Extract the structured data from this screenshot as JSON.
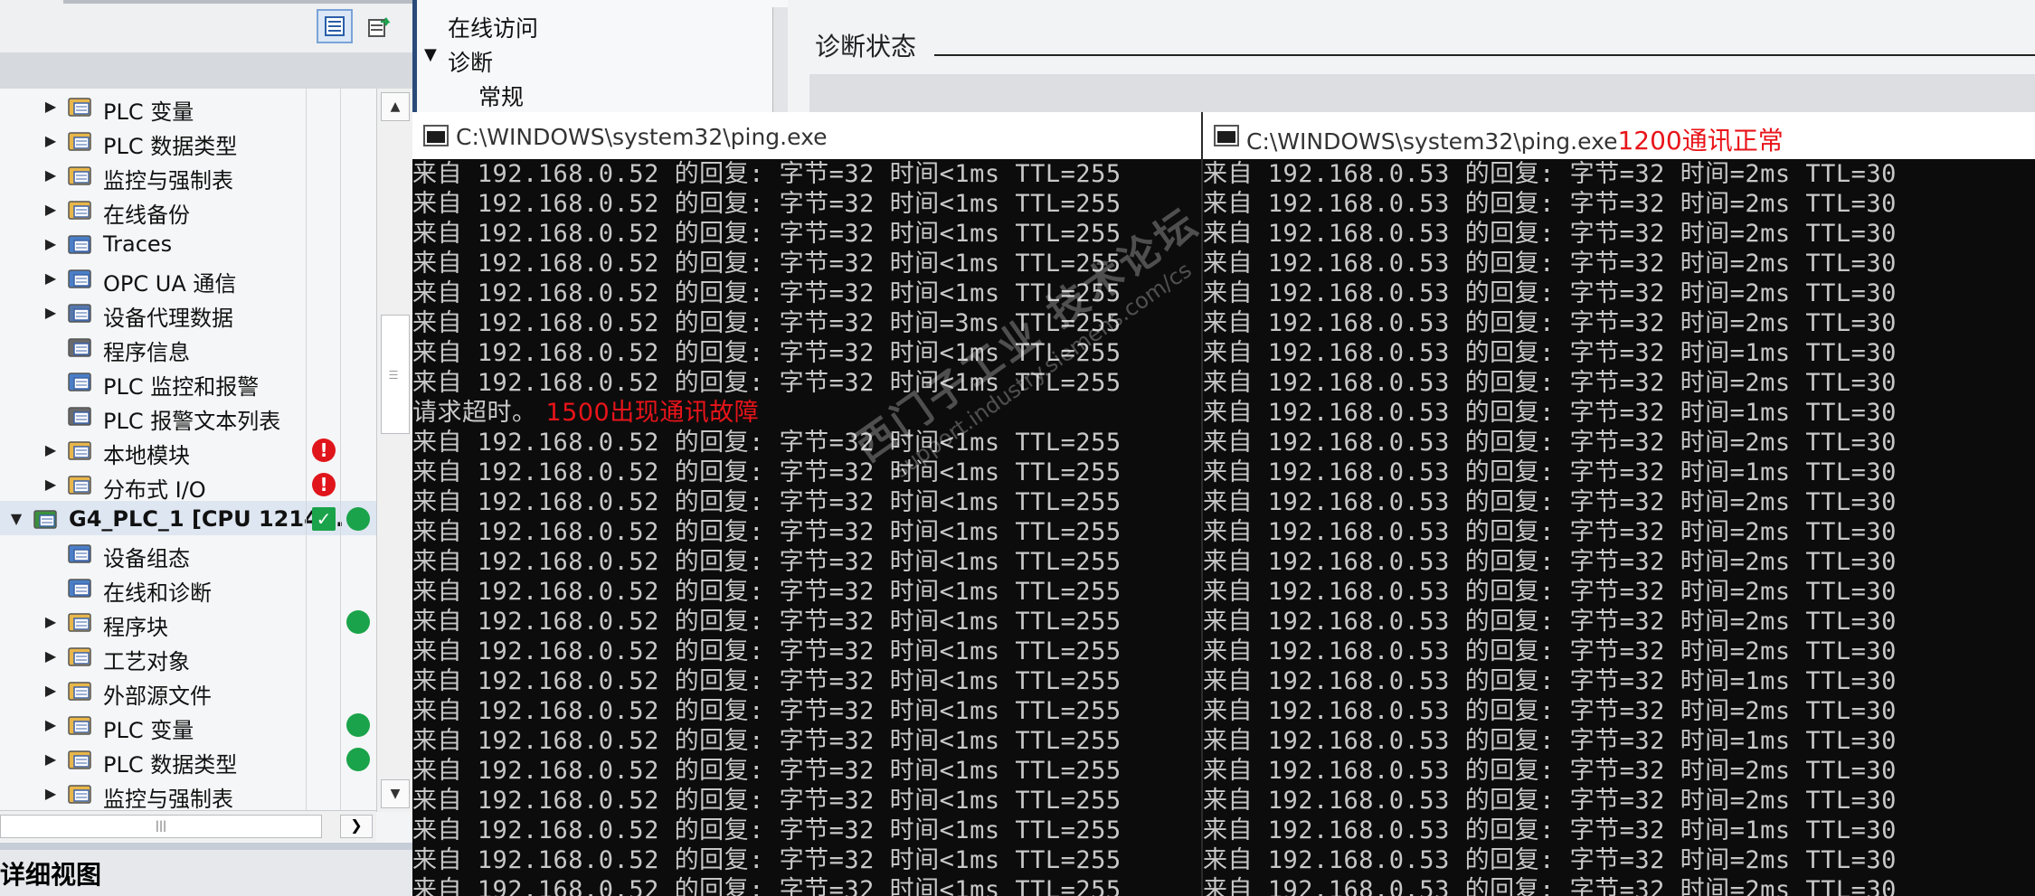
{
  "tree": {
    "items": [
      {
        "label": "PLC 变量",
        "indent": 1,
        "expand": "▶",
        "icon": "plc-tag-folder-icon"
      },
      {
        "label": "PLC 数据类型",
        "indent": 1,
        "expand": "▶",
        "icon": "plc-datatype-folder-icon"
      },
      {
        "label": "监控与强制表",
        "indent": 1,
        "expand": "▶",
        "icon": "watch-table-folder-icon"
      },
      {
        "label": "在线备份",
        "indent": 1,
        "expand": "▶",
        "icon": "online-backup-icon"
      },
      {
        "label": "Traces",
        "indent": 1,
        "expand": "▶",
        "icon": "traces-icon"
      },
      {
        "label": "OPC UA 通信",
        "indent": 1,
        "expand": "▶",
        "icon": "opc-ua-icon"
      },
      {
        "label": "设备代理数据",
        "indent": 1,
        "expand": "▶",
        "icon": "device-proxy-icon"
      },
      {
        "label": "程序信息",
        "indent": 1,
        "expand": "",
        "icon": "program-info-icon"
      },
      {
        "label": "PLC 监控和报警",
        "indent": 1,
        "expand": "",
        "icon": "plc-alarm-icon"
      },
      {
        "label": "PLC 报警文本列表",
        "indent": 1,
        "expand": "",
        "icon": "alarm-text-list-icon"
      },
      {
        "label": "本地模块",
        "indent": 1,
        "expand": "▶",
        "icon": "local-modules-icon",
        "status": "error"
      },
      {
        "label": "分布式 I/O",
        "indent": 1,
        "expand": "▶",
        "icon": "distributed-io-icon",
        "status": "error"
      },
      {
        "label": "G4_PLC_1 [CPU 1214...",
        "indent": 0,
        "expand": "▼",
        "icon": "plc-device-icon",
        "status": "ok-both",
        "selected": true
      },
      {
        "label": "设备组态",
        "indent": 1,
        "expand": "",
        "icon": "device-config-icon"
      },
      {
        "label": "在线和诊断",
        "indent": 1,
        "expand": "",
        "icon": "online-diagnostics-icon"
      },
      {
        "label": "程序块",
        "indent": 1,
        "expand": "▶",
        "icon": "program-blocks-icon",
        "status": "ok"
      },
      {
        "label": "工艺对象",
        "indent": 1,
        "expand": "▶",
        "icon": "technology-objects-icon"
      },
      {
        "label": "外部源文件",
        "indent": 1,
        "expand": "▶",
        "icon": "external-sources-icon"
      },
      {
        "label": "PLC 变量",
        "indent": 1,
        "expand": "▶",
        "icon": "plc-tag-folder-icon",
        "status": "ok"
      },
      {
        "label": "PLC 数据类型",
        "indent": 1,
        "expand": "▶",
        "icon": "plc-datatype-folder-icon",
        "status": "ok"
      },
      {
        "label": "监控与强制表",
        "indent": 1,
        "expand": "▶",
        "icon": "watch-table-folder-icon"
      }
    ],
    "scroll_up": "▲",
    "scroll_down": "▼",
    "hscroll_right": "❯",
    "hthumb_grip": "|||"
  },
  "detail": {
    "title": "详细视图"
  },
  "diag_nav": {
    "online_access": "在线访问",
    "diagnostics": "诊断",
    "diagnostics_arrow": "▼",
    "general": "常规"
  },
  "diag_status": {
    "title": "诊断状态"
  },
  "console_left": {
    "title": "C:\\WINDOWS\\system32\\ping.exe",
    "note": "",
    "lines": [
      "来自 192.168.0.52 的回复: 字节=32 时间<1ms TTL=255",
      "来自 192.168.0.52 的回复: 字节=32 时间<1ms TTL=255",
      "来自 192.168.0.52 的回复: 字节=32 时间<1ms TTL=255",
      "来自 192.168.0.52 的回复: 字节=32 时间<1ms TTL=255",
      "来自 192.168.0.52 的回复: 字节=32 时间<1ms TTL=255",
      "来自 192.168.0.52 的回复: 字节=32 时间=3ms TTL=255",
      "来自 192.168.0.52 的回复: 字节=32 时间<1ms TTL=255",
      "来自 192.168.0.52 的回复: 字节=32 时间<1ms TTL=255",
      "请求超时。",
      "来自 192.168.0.52 的回复: 字节=32 时间<1ms TTL=255",
      "来自 192.168.0.52 的回复: 字节=32 时间<1ms TTL=255",
      "来自 192.168.0.52 的回复: 字节=32 时间<1ms TTL=255",
      "来自 192.168.0.52 的回复: 字节=32 时间<1ms TTL=255",
      "来自 192.168.0.52 的回复: 字节=32 时间<1ms TTL=255",
      "来自 192.168.0.52 的回复: 字节=32 时间<1ms TTL=255",
      "来自 192.168.0.52 的回复: 字节=32 时间<1ms TTL=255",
      "来自 192.168.0.52 的回复: 字节=32 时间<1ms TTL=255",
      "来自 192.168.0.52 的回复: 字节=32 时间<1ms TTL=255",
      "来自 192.168.0.52 的回复: 字节=32 时间<1ms TTL=255",
      "来自 192.168.0.52 的回复: 字节=32 时间<1ms TTL=255",
      "来自 192.168.0.52 的回复: 字节=32 时间<1ms TTL=255",
      "来自 192.168.0.52 的回复: 字节=32 时间<1ms TTL=255",
      "来自 192.168.0.52 的回复: 字节=32 时间<1ms TTL=255",
      "来自 192.168.0.52 的回复: 字节=32 时间<1ms TTL=255",
      "来自 192.168.0.52 的回复: 字节=32 时间<1ms TTL=255"
    ],
    "timeout_note": "1500出现通讯故障"
  },
  "console_right": {
    "title": "C:\\WINDOWS\\system32\\ping.exe",
    "note": "1200通讯正常",
    "lines": [
      "来自 192.168.0.53 的回复: 字节=32 时间=2ms TTL=30",
      "来自 192.168.0.53 的回复: 字节=32 时间=2ms TTL=30",
      "来自 192.168.0.53 的回复: 字节=32 时间=2ms TTL=30",
      "来自 192.168.0.53 的回复: 字节=32 时间=2ms TTL=30",
      "来自 192.168.0.53 的回复: 字节=32 时间=2ms TTL=30",
      "来自 192.168.0.53 的回复: 字节=32 时间=2ms TTL=30",
      "来自 192.168.0.53 的回复: 字节=32 时间=1ms TTL=30",
      "来自 192.168.0.53 的回复: 字节=32 时间=2ms TTL=30",
      "来自 192.168.0.53 的回复: 字节=32 时间=1ms TTL=30",
      "来自 192.168.0.53 的回复: 字节=32 时间=2ms TTL=30",
      "来自 192.168.0.53 的回复: 字节=32 时间=1ms TTL=30",
      "来自 192.168.0.53 的回复: 字节=32 时间=2ms TTL=30",
      "来自 192.168.0.53 的回复: 字节=32 时间=2ms TTL=30",
      "来自 192.168.0.53 的回复: 字节=32 时间=2ms TTL=30",
      "来自 192.168.0.53 的回复: 字节=32 时间=2ms TTL=30",
      "来自 192.168.0.53 的回复: 字节=32 时间=2ms TTL=30",
      "来自 192.168.0.53 的回复: 字节=32 时间=2ms TTL=30",
      "来自 192.168.0.53 的回复: 字节=32 时间=1ms TTL=30",
      "来自 192.168.0.53 的回复: 字节=32 时间=2ms TTL=30",
      "来自 192.168.0.53 的回复: 字节=32 时间=1ms TTL=30",
      "来自 192.168.0.53 的回复: 字节=32 时间=2ms TTL=30",
      "来自 192.168.0.53 的回复: 字节=32 时间=2ms TTL=30",
      "来自 192.168.0.53 的回复: 字节=32 时间=1ms TTL=30",
      "来自 192.168.0.53 的回复: 字节=32 时间=2ms TTL=30",
      "来自 192.168.0.53 的回复: 字节=32 时间=2ms TTL=30"
    ]
  },
  "watermark": {
    "main": "西门子工业 技术论坛",
    "sub": "support.industry.siemens.com/cs"
  },
  "colors": {
    "ok": "#1aa34a",
    "error": "#e0151b",
    "note": "#e8141a",
    "check_bg": "#1aa34a"
  }
}
